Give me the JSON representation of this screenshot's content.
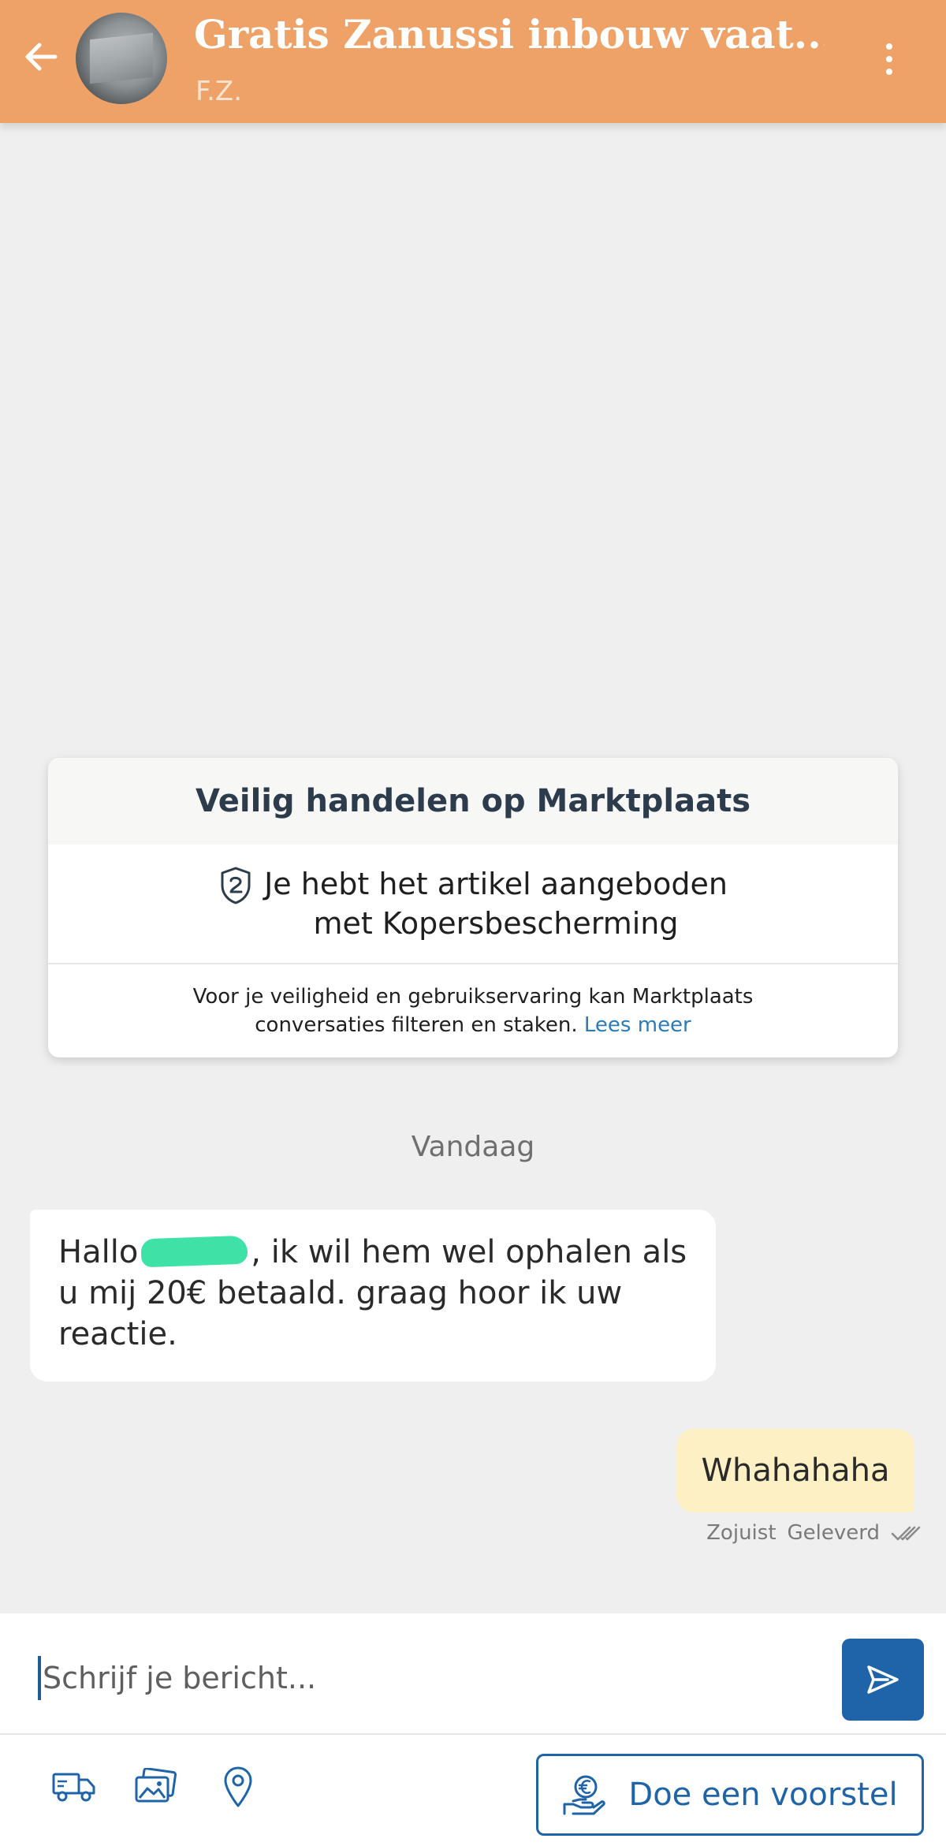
{
  "header": {
    "title": "Gratis Zanussi inbouw vaat...",
    "subtitle": "F.Z.",
    "back_icon": "arrow-left-icon",
    "more_icon": "more-vertical-icon",
    "color": "#EFA267"
  },
  "safety_card": {
    "heading": "Veilig handelen op Marktplaats",
    "protection_line1": "Je hebt het artikel aangeboden",
    "protection_line2": "met Kopersbescherming",
    "notice_line1": "Voor je veiligheid en gebruikservaring kan Marktplaats",
    "notice_line2": "conversaties filteren en staken.",
    "link": "Lees meer"
  },
  "chat": {
    "day_label": "Vandaag",
    "incoming": {
      "prefix": "Hallo",
      "rest": ",  ik wil hem wel ophalen als u mij 20€ betaald. graag hoor ik uw reactie."
    },
    "outgoing": {
      "text": "Whahahaha",
      "time": "Zojuist",
      "status": "Geleverd"
    }
  },
  "composer": {
    "placeholder": "Schrijf je bericht...",
    "offer_label": "Doe een voorstel",
    "accent": "#1F64A8"
  }
}
